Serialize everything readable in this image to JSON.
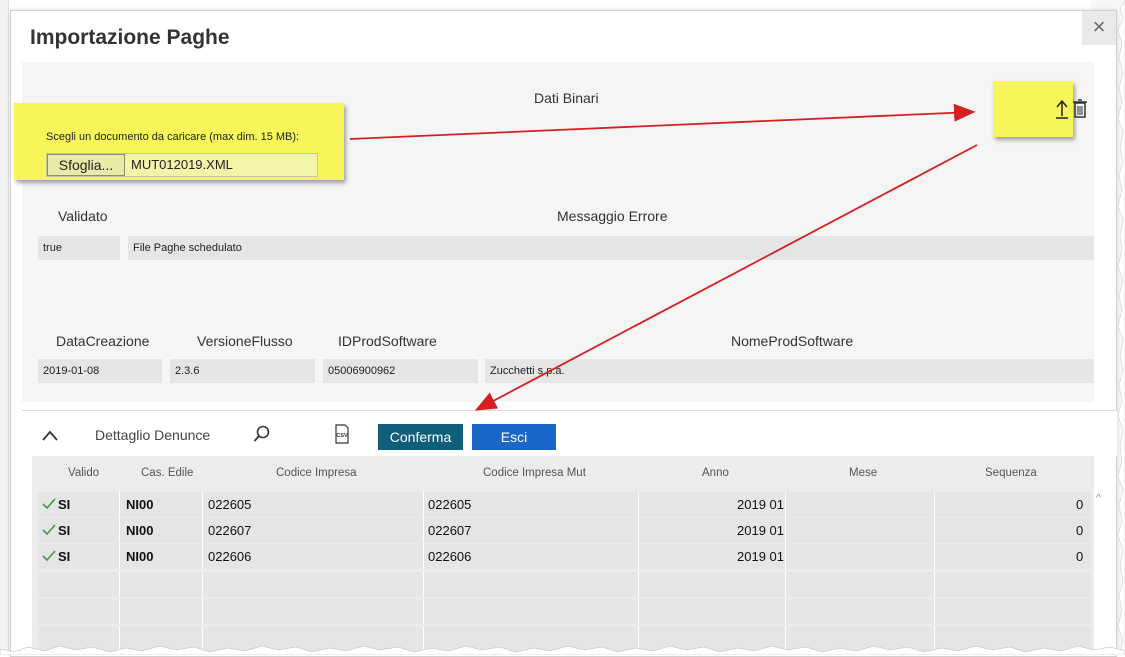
{
  "dialog": {
    "title": "Importazione Paghe",
    "close_glyph": "×"
  },
  "form": {
    "dati_binari_label": "Dati Binari",
    "upload_prompt": "Scegli un documento da caricare (max dim. 15 MB):",
    "browse_label": "Sfoglia...",
    "file_name": "MUT012019.XML",
    "upload_icon": "upload-arrow-icon",
    "delete_icon": "trash-icon",
    "validato_label": "Validato",
    "validato_value": "true",
    "messaggio_errore_label": "Messaggio Errore",
    "messaggio_errore_value": "File Paghe schedulato",
    "data_creazione_label": "DataCreazione",
    "data_creazione_value": "2019-01-08",
    "versione_flusso_label": "VersioneFlusso",
    "versione_flusso_value": "2.3.6",
    "id_prod_software_label": "IDProdSoftware",
    "id_prod_software_value": "05006900962",
    "nome_prod_software_label": "NomeProdSoftware",
    "nome_prod_software_value": "Zucchetti s.p.a."
  },
  "toolbar": {
    "section_title": "Dettaglio Denunce",
    "collapse_icon": "chevron-up-icon",
    "search_icon": "search-icon",
    "csv_icon": "csv-export-icon",
    "confirm_label": "Conferma",
    "exit_label": "Esci"
  },
  "grid": {
    "columns": [
      "Valido",
      "Cas. Edile",
      "Codice Impresa",
      "Codice Impresa Mut",
      "Anno",
      "Mese",
      "Sequenza"
    ],
    "rows": [
      {
        "valido": "SI",
        "cas_edile": "NI00",
        "codice_impresa": "022605",
        "codice_impresa_mut": "022605",
        "anno_mese": "2019 01",
        "sequenza": "0"
      },
      {
        "valido": "SI",
        "cas_edile": "NI00",
        "codice_impresa": "022607",
        "codice_impresa_mut": "022607",
        "anno_mese": "2019 01",
        "sequenza": "0"
      },
      {
        "valido": "SI",
        "cas_edile": "NI00",
        "codice_impresa": "022606",
        "codice_impresa_mut": "022606",
        "anno_mese": "2019 01",
        "sequenza": "0"
      }
    ],
    "check_icon": "check-icon"
  },
  "colors": {
    "confirm_button": "#0f5e7a",
    "exit_button": "#1a67c7",
    "highlight": "#f6f65a",
    "annotation_arrow": "#d42020",
    "check": "#3aa03a"
  }
}
